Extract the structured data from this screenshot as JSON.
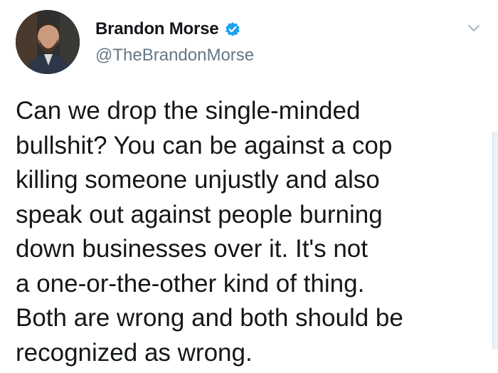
{
  "tweet": {
    "author": {
      "display_name": "Brandon Morse",
      "handle": "@TheBrandonMorse",
      "verified": true
    },
    "text_lines": [
      "Can we drop the single-minded",
      "bullshit? You can be against a cop",
      "killing someone unjustly and also",
      "speak out against people burning",
      "down businesses over it. It's not",
      "a one-or-the-other kind of thing.",
      "Both are wrong and both should be",
      "recognized as wrong."
    ]
  },
  "icons": {
    "verified": "verified-badge-icon",
    "menu": "chevron-down-icon"
  },
  "colors": {
    "verified_blue": "#1da1f2",
    "handle_gray": "#657786",
    "text": "#14171a",
    "chevron_gray": "#aab8c2"
  }
}
